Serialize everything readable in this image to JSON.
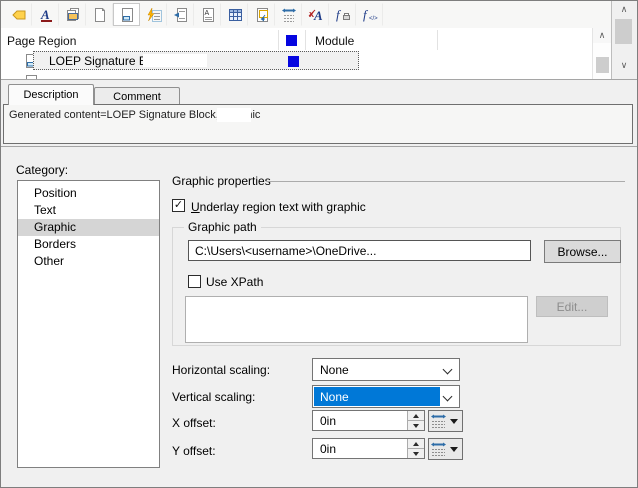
{
  "icons": {
    "check": "✓",
    "scroll_up": "∧",
    "scroll_down": "∨"
  },
  "colors": {
    "accent_blue": "#0078D7",
    "marker_blue": "#0505E0",
    "window_bg": "#F0F0F0"
  },
  "toolbar": {
    "icons": [
      "tag",
      "font-style",
      "copy-module",
      "new-page",
      "page-region",
      "dynamic-content",
      "indent-region",
      "text-region",
      "table",
      "insert-table",
      "spacing",
      "font-replace",
      "function-print",
      "function-code"
    ]
  },
  "region_list": {
    "columns": [
      "Page Region",
      "Module"
    ],
    "rows": [
      {
        "name": "LOEP Signature Block",
        "marker": "blue-square"
      }
    ]
  },
  "tabs": [
    {
      "label": "Description",
      "active": true
    },
    {
      "label": "Comment",
      "active": false
    }
  ],
  "description_panel": {
    "text": "Generated content=LOEP Signature Block, Graphic"
  },
  "properties": {
    "category_label": "Category:",
    "categories": [
      "Position",
      "Text",
      "Graphic",
      "Borders",
      "Other"
    ],
    "selected_category": "Graphic",
    "group_title": "Graphic properties",
    "underlay_checkbox": {
      "label": "Underlay region text with graphic",
      "checked": true
    },
    "graphic_path_group": {
      "title": "Graphic path",
      "path_value": "C:\\Users\\<username>\\OneDrive...",
      "browse_button": "Browse...",
      "use_xpath": {
        "label": "Use XPath",
        "checked": false
      },
      "xpath_value": "",
      "edit_button": "Edit...",
      "edit_enabled": false
    },
    "fields": [
      {
        "label": "Horizontal scaling:",
        "value": "None",
        "type": "combo",
        "focused": false
      },
      {
        "label": "Vertical scaling:",
        "value": "None",
        "type": "combo",
        "focused": true
      },
      {
        "label": "X offset:",
        "value": "0in",
        "type": "spinner"
      },
      {
        "label": "Y offset:",
        "value": "0in",
        "type": "spinner"
      }
    ]
  }
}
